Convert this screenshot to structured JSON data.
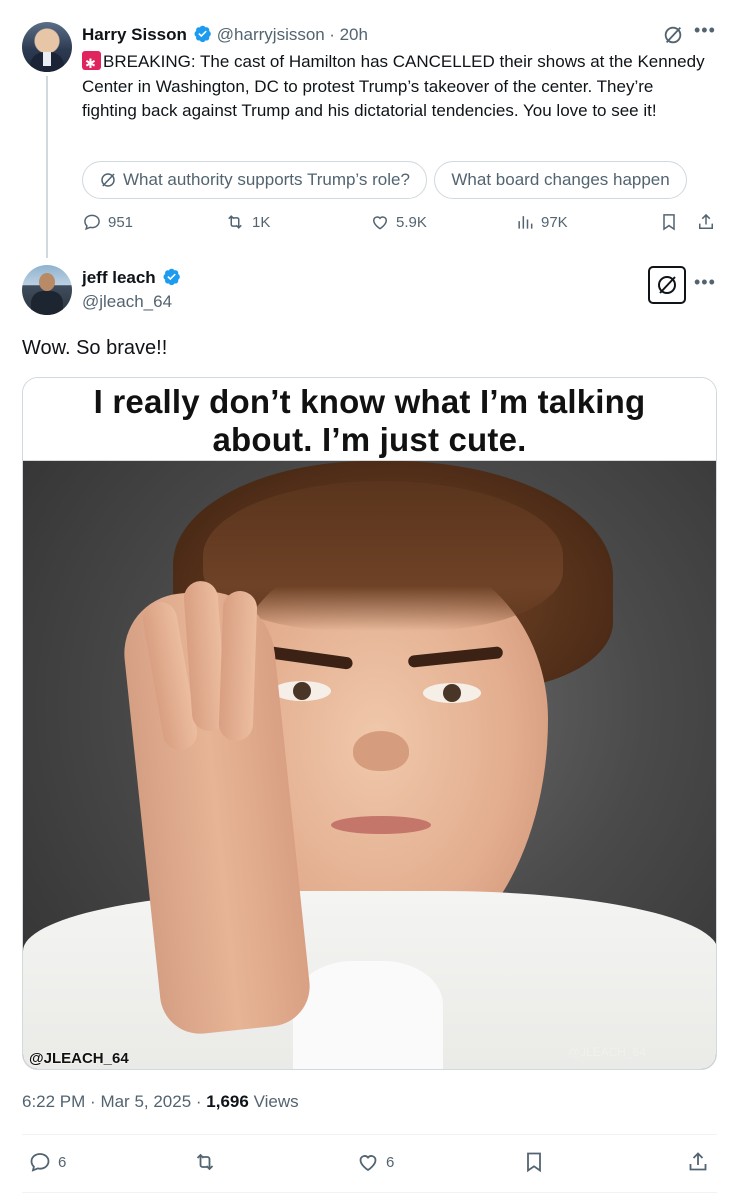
{
  "parent_tweet": {
    "author_name": "Harry Sisson",
    "handle": "@harryjsisson",
    "time": "20h",
    "text": "BREAKING: The cast of Hamilton has CANCELLED their shows at the Kennedy Center in Washington, DC to protest Trump’s takeover of the center. They’re fighting back against Trump and his dictatorial tendencies. You love to see it!",
    "grok_prompts": [
      "What authority supports Trump’s role?",
      "What board changes happen"
    ],
    "stats": {
      "replies": "951",
      "reposts": "1K",
      "likes": "5.9K",
      "views": "97K"
    }
  },
  "reply_tweet": {
    "author_name": "jeff leach",
    "handle": "@jleach_64",
    "text": "Wow. So brave!!",
    "media": {
      "caption_line1": "I really don’t know what I’m talking",
      "caption_line2": "about. I’m just cute.",
      "watermark": "@JLEACH_64",
      "watermark_faint": "@JLEACH_64"
    },
    "time": "6:22 PM",
    "date": "Mar 5, 2025",
    "views_count": "1,696",
    "views_label": "Views",
    "stats": {
      "replies": "6",
      "likes": "6"
    }
  },
  "colors": {
    "text_primary": "#0f1419",
    "text_secondary": "#536471",
    "verified_blue": "#1d9bf0",
    "border": "#cfd9de"
  }
}
